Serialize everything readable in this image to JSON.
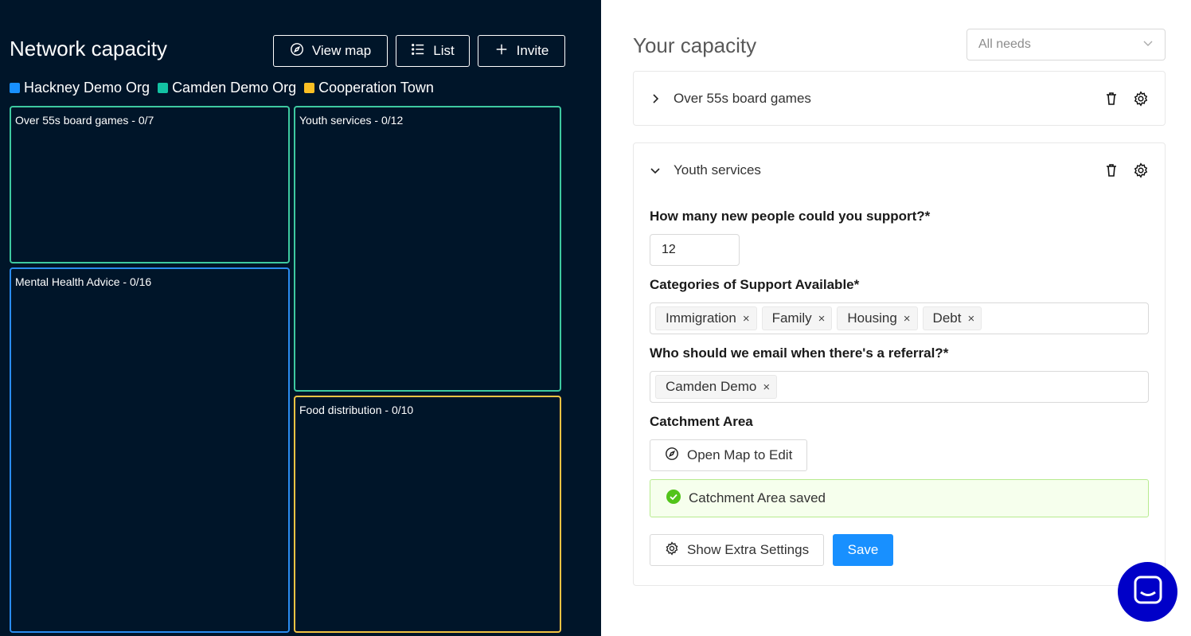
{
  "left": {
    "title": "Network capacity",
    "buttons": {
      "view_map": "View map",
      "list": "List",
      "invite": "Invite"
    },
    "legend": [
      {
        "label": "Hackney Demo Org",
        "color": "#1890ff"
      },
      {
        "label": "Camden Demo Org",
        "color": "#13c2a3"
      },
      {
        "label": "Cooperation Town",
        "color": "#fbbf24"
      }
    ],
    "tiles": [
      {
        "label": "Over 55s board games - 0/7",
        "color": "#3ec9a0"
      },
      {
        "label": "Youth services - 0/12",
        "color": "#3ec9a0"
      },
      {
        "label": "Mental Health Advice - 0/16",
        "color": "#2a8cf0"
      },
      {
        "label": "Food distribution - 0/10",
        "color": "#f5c343"
      }
    ]
  },
  "right": {
    "title": "Your capacity",
    "needs_select": "All needs",
    "cards": [
      {
        "label": "Over 55s board games"
      },
      {
        "label": "Youth services"
      }
    ],
    "form": {
      "capacity_label": "How many new people could you support?*",
      "capacity_value": "12",
      "categories_label": "Categories of Support Available*",
      "categories": [
        "Immigration",
        "Family",
        "Housing",
        "Debt"
      ],
      "email_label": "Who should we email when there's a referral?*",
      "emails": [
        "Camden Demo"
      ],
      "catchment_label": "Catchment Area",
      "open_map_label": "Open Map to Edit",
      "saved_message": "Catchment Area saved",
      "extra_settings_label": "Show Extra Settings",
      "save_label": "Save"
    },
    "tag_remove_glyph": "×"
  }
}
